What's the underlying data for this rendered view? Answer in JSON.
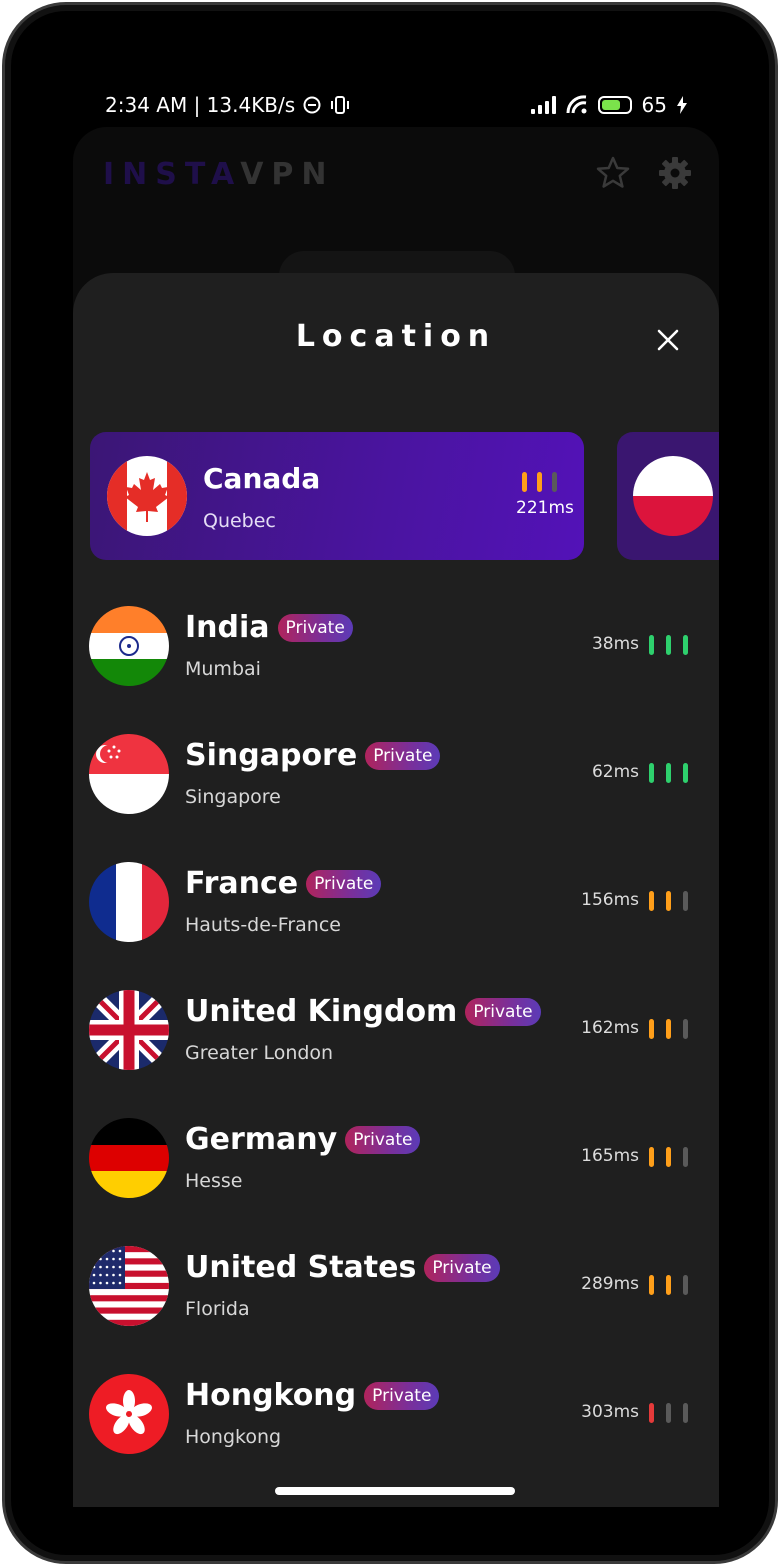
{
  "status_bar": {
    "time_info": "2:34 AM | 13.4KB/s",
    "battery": "65"
  },
  "header": {
    "logo_part1": "INSTA",
    "logo_part2": "VPN"
  },
  "sheet": {
    "title": "Location"
  },
  "featured": {
    "country": "Canada",
    "city": "Quebec",
    "ping": "221ms",
    "signal": [
      "orange",
      "orange",
      "gray"
    ]
  },
  "badge_label": "Private",
  "locations": [
    {
      "country": "India",
      "city": "Mumbai",
      "ping": "38ms",
      "signal": [
        "green",
        "green",
        "green"
      ]
    },
    {
      "country": "Singapore",
      "city": "Singapore",
      "ping": "62ms",
      "signal": [
        "green",
        "green",
        "green"
      ]
    },
    {
      "country": "France",
      "city": "Hauts-de-France",
      "ping": "156ms",
      "signal": [
        "orange",
        "orange",
        "gray"
      ]
    },
    {
      "country": "United Kingdom",
      "city": "Greater London",
      "ping": "162ms",
      "signal": [
        "orange",
        "orange",
        "gray"
      ]
    },
    {
      "country": "Germany",
      "city": "Hesse",
      "ping": "165ms",
      "signal": [
        "orange",
        "orange",
        "gray"
      ]
    },
    {
      "country": "United States",
      "city": "Florida",
      "ping": "289ms",
      "signal": [
        "orange",
        "orange",
        "gray"
      ]
    },
    {
      "country": "Hongkong",
      "city": "Hongkong",
      "ping": "303ms",
      "signal": [
        "red",
        "gray",
        "gray"
      ]
    }
  ]
}
